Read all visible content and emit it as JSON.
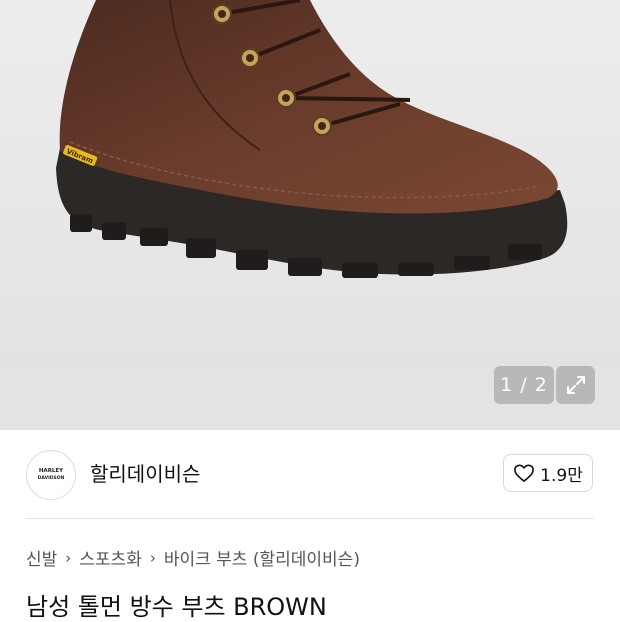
{
  "gallery": {
    "image_alt": "brown leather hiking boot",
    "counter": "1 / 2",
    "sole_brand": "Vibram"
  },
  "brand": {
    "logo_line1": "HARLEY",
    "logo_line2": "DAVIDSON",
    "name": "할리데이비슨",
    "likes": "1.9만"
  },
  "breadcrumb": [
    "신발",
    "스포츠화",
    "바이크 부츠 (할리데이비슨)"
  ],
  "product": {
    "title": "남성 톨먼 방수 부츠 BROWN"
  },
  "icons": {
    "expand": "expand-icon",
    "heart": "heart-icon",
    "chevron": "chevron-right-icon"
  },
  "colors": {
    "boot_leather": "#5a3426",
    "boot_sole": "#2b2826",
    "vibram_yellow": "#e8b91b"
  }
}
